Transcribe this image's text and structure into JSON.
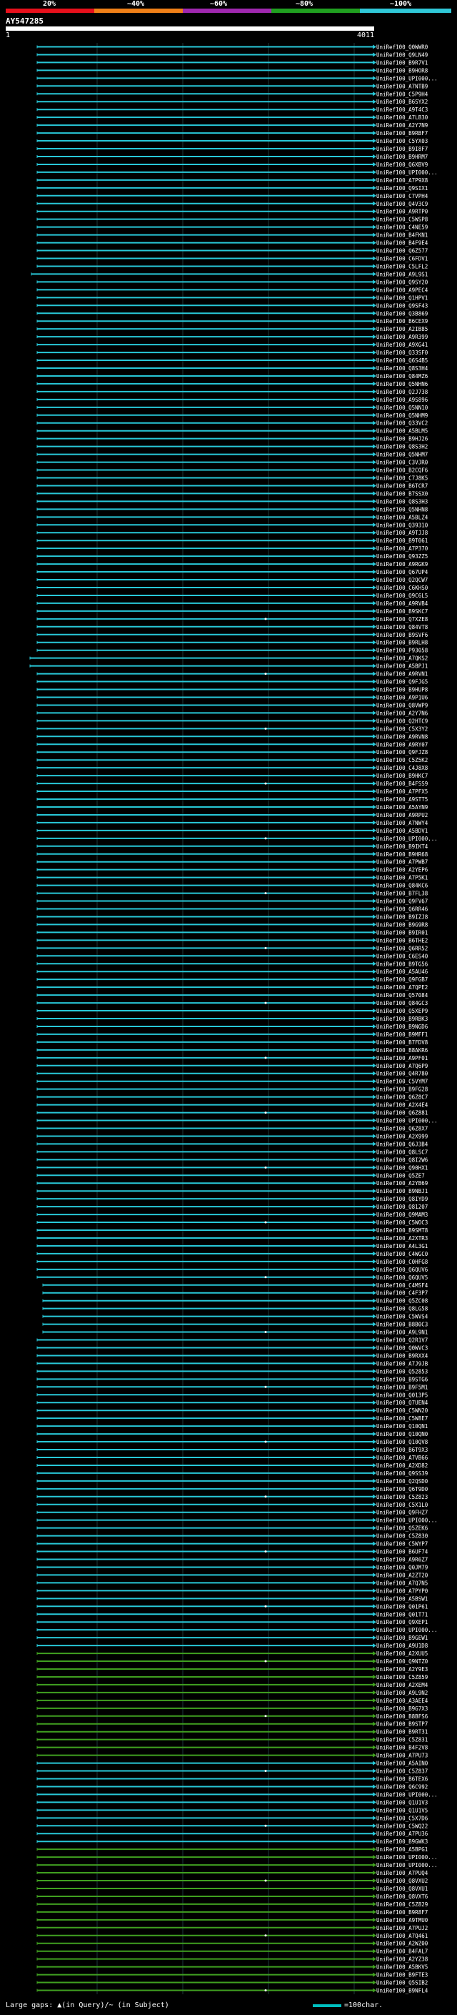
{
  "query": {
    "id": "AY547285",
    "start": "1",
    "end": "4011"
  },
  "scale_labels": [
    "20%",
    "~40%",
    "~60%",
    "~80%",
    "~100%"
  ],
  "scale_colors": [
    "#e8101c",
    "#f08018",
    "#a028b0",
    "#20a020",
    "#30c8d8"
  ],
  "colors": {
    "hit_cyan": "#28c8d8",
    "hit_green": "#40a020",
    "label": "#ffffff",
    "background": "#000000",
    "query_bar": "#ffffff"
  },
  "footer": {
    "left": "Large gaps: ▲(in Query)/~ (in Subject)",
    "right": "=100char."
  },
  "hits": [
    "UniRef100_Q0WWR0",
    "UniRef100_Q9LN49",
    "UniRef100_B9R7V1",
    "UniRef100_B9HOR8",
    "UniRef100_UPI000...",
    "UniRef100_A7NTB9",
    "UniRef100_C5P9H4",
    "UniRef100_B6SYX2",
    "UniRef100_A9T4C3",
    "UniRef100_A7LB30",
    "UniRef100_A2Y7N9",
    "UniRef100_B9RBF7",
    "UniRef100_C5YX03",
    "UniRef100_B9I8F7",
    "UniRef100_B9HRM7",
    "UniRef100_Q6XBV9",
    "UniRef100_UPI000...",
    "UniRef100_A7P9X8",
    "UniRef100_Q9SIX1",
    "UniRef100_C7VPH4",
    "UniRef100_Q4V3C9",
    "UniRef100_A9RTP0",
    "UniRef100_C5WSP8",
    "UniRef100_C4NE59",
    "UniRef100_B4FKN1",
    "UniRef100_B4F9E4",
    "UniRef100_Q6Z577",
    "UniRef100_C6FDV1",
    "UniRef100_C5LFL2",
    "UniRef100_A9L9S1",
    "UniRef100_Q9SY20",
    "UniRef100_A9PEC4",
    "UniRef100_Q1HPV1",
    "UniRef100_Q9SF43",
    "UniRef100_Q3B869",
    "UniRef100_B6CEX9",
    "UniRef100_A2IB85",
    "UniRef100_A9R399",
    "UniRef100_A9XG41",
    "UniRef100_Q33SF0",
    "UniRef100_Q6S4B5",
    "UniRef100_Q8S3H4",
    "UniRef100_Q84MZ6",
    "UniRef100_Q5NHN6",
    "UniRef100_Q2J738",
    "UniRef100_A9S896",
    "UniRef100_Q5NN10",
    "UniRef100_Q5NHM9",
    "UniRef100_Q33VC2",
    "UniRef100_A5BLM5",
    "UniRef100_B9HJ26",
    "UniRef100_Q8S3H2",
    "UniRef100_Q5NHM7",
    "UniRef100_C3VJR0",
    "UniRef100_B2CQF6",
    "UniRef100_C7J8K5",
    "UniRef100_B6TCR7",
    "UniRef100_B7SSX0",
    "UniRef100_Q8S3H3",
    "UniRef100_Q5NHN8",
    "UniRef100_A5BLZ4",
    "UniRef100_Q39310",
    "UniRef100_A9TJJ8",
    "UniRef100_B9T061",
    "UniRef100_A7P370",
    "UniRef100_Q93ZZ5",
    "UniRef100_A9RGK9",
    "UniRef100_Q67UP4",
    "UniRef100_Q2QCW7",
    "UniRef100_C6KHS0",
    "UniRef100_Q9C6L5",
    "UniRef100_A9RVB4",
    "UniRef100_B9SKC7",
    "UniRef100_Q7XZE8",
    "UniRef100_Q84VT8",
    "UniRef100_B9SVF6",
    "UniRef100_B9RLH8",
    "UniRef100_P93058",
    "UniRef100_A7QKS2",
    "UniRef100_A5BPJ1",
    "UniRef100_A9RVN1",
    "UniRef100_Q9FJG5",
    "UniRef100_B9HUP8",
    "UniRef100_A9P1U6",
    "UniRef100_Q8VWP9",
    "UniRef100_A2Y7N6",
    "UniRef100_Q2HTC9",
    "UniRef100_C5X3Y2",
    "UniRef100_A9RVN8",
    "UniRef100_A9RY07",
    "UniRef100_Q9FJZ8",
    "UniRef100_C5Z5K2",
    "UniRef100_C4J8X8",
    "UniRef100_B9HKC7",
    "UniRef100_B4FSS9",
    "UniRef100_A7PFX5",
    "UniRef100_A9STT5",
    "UniRef100_A5AYN9",
    "UniRef100_A9RPU2",
    "UniRef100_A7NWY4",
    "UniRef100_A5BDV1",
    "UniRef100_UPI000...",
    "UniRef100_B9IKT4",
    "UniRef100_B9HR68",
    "UniRef100_A7PWB7",
    "UniRef100_A2YEP6",
    "UniRef100_A7P5K1",
    "UniRef100_Q84KC6",
    "UniRef100_B7FL38",
    "UniRef100_Q9FV67",
    "UniRef100_Q6RR46",
    "UniRef100_B9IZJ8",
    "UniRef100_B9G9R8",
    "UniRef100_B9IR01",
    "UniRef100_B6THE2",
    "UniRef100_Q6RR52",
    "UniRef100_C6ES40",
    "UniRef100_B9TG56",
    "UniRef100_A5AU46",
    "UniRef100_Q9FGB7",
    "UniRef100_A7QPE2",
    "UniRef100_Q57084",
    "UniRef100_Q84GC3",
    "UniRef100_Q5XEP9",
    "UniRef100_B9RBK3",
    "UniRef100_B9NGD6",
    "UniRef100_B9MFF1",
    "UniRef100_B7FDV8",
    "UniRef100_B8AKR6",
    "UniRef100_A9PF01",
    "UniRef100_A7Q6P9",
    "UniRef100_Q4R780",
    "UniRef100_C5VYM7",
    "UniRef100_B9FG28",
    "UniRef100_Q6Z8C7",
    "UniRef100_A2X4E4",
    "UniRef100_Q6Z881",
    "UniRef100_UPI000...",
    "UniRef100_Q6Z8X7",
    "UniRef100_A2X999",
    "UniRef100_Q6J3B4",
    "UniRef100_Q8LSC7",
    "UniRef100_Q8I2W6",
    "UniRef100_Q90HX1",
    "UniRef100_Q5ZE7",
    "UniRef100_A2YB69",
    "UniRef100_B9NBJ1",
    "UniRef100_Q8IYD9",
    "UniRef100_Q81207",
    "UniRef100_Q9MAM3",
    "UniRef100_C5WOC3",
    "UniRef100_B9SMT8",
    "UniRef100_A2XTR3",
    "UniRef100_A4L3G1",
    "UniRef100_C4WGC0",
    "UniRef100_C0HFG8",
    "UniRef100_Q6QUV6",
    "UniRef100_Q6QUV5",
    "UniRef100_C4MSF4",
    "UniRef100_C4F3P7",
    "UniRef100_Q5ZC08",
    "UniRef100_Q8LG58",
    "UniRef100_C5WVS4",
    "UniRef100_B8B0C3",
    "UniRef100_A9L9N1",
    "UniRef100_Q2R1V7",
    "UniRef100_Q0WVC3",
    "UniRef100_B9RXX4",
    "UniRef100_A7J9JB",
    "UniRef100_Q52853",
    "UniRef100_B9STG6",
    "UniRef100_B9F5M1",
    "UniRef100_Q013P5",
    "UniRef100_Q7UEN4",
    "UniRef100_C5WN20",
    "UniRef100_C5W8E7",
    "UniRef100_Q10QN1",
    "UniRef100_Q10QN0",
    "UniRef100_Q10QV8",
    "UniRef100_B6T9X3",
    "UniRef100_A7VB66",
    "UniRef100_A2XD82",
    "UniRef100_Q9SS39",
    "UniRef100_Q2QSD0",
    "UniRef100_Q6T9D0",
    "UniRef100_C5Z823",
    "UniRef100_C5X1L0",
    "UniRef100_Q9FHZ7",
    "UniRef100_UPI000...",
    "UniRef100_Q5ZEK6",
    "UniRef100_C5Z830",
    "UniRef100_C5WYP7",
    "UniRef100_B6UF74",
    "UniRef100_A9R6Z7",
    "UniRef100_Q0JM79",
    "UniRef100_A2ZT20",
    "UniRef100_A7Q7N5",
    "UniRef100_A7PYP0",
    "UniRef100_A5BSW1",
    "UniRef100_Q01P61",
    "UniRef100_Q01T71",
    "UniRef100_Q9XEP1",
    "UniRef100_UPI000...",
    "UniRef100_B9GEW1",
    "UniRef100_A9U1D8",
    "UniRef100_A2XUU5",
    "UniRef100_Q9NTZ0",
    "UniRef100_A2Y9E3",
    "UniRef100_C5Z859",
    "UniRef100_A2XEM4",
    "UniRef100_A9L9N2",
    "UniRef100_A3AEE4",
    "UniRef100_B9G7X3",
    "UniRef100_B8BFS6",
    "UniRef100_B9STP7",
    "UniRef100_B9RT31",
    "UniRef100_C5Z831",
    "UniRef100_B4F2V8",
    "UniRef100_A7PU73",
    "UniRef100_A5AIN0",
    "UniRef100_C5Z837",
    "UniRef100_B6TEX6",
    "UniRef100_Q6C992",
    "UniRef100_UPI000...",
    "UniRef100_Q1U1V3",
    "UniRef100_Q1U1V5",
    "UniRef100_C5X7D6",
    "UniRef100_C5WQ22",
    "UniRef100_A7PU36",
    "UniRef100_B9GWK3",
    "UniRef100_A5BPG1",
    "UniRef100_UPI000...",
    "UniRef100_UPI000...",
    "UniRef100_A7PUQ4",
    "UniRef100_Q8VXU2",
    "UniRef100_Q8VXU1",
    "UniRef100_Q8VXT6",
    "UniRef100_C5Z829",
    "UniRef100_B9R8F7",
    "UniRef100_A9TMU0",
    "UniRef100_A7PUJ2",
    "UniRef100_A7Q461",
    "UniRef100_A2WZ00",
    "UniRef100_B4FAL7",
    "UniRef100_A2YZ38",
    "UniRef100_A5BKV5",
    "UniRef100_B9FTE3",
    "UniRef100_Q5SIB2",
    "UniRef100_B9NFL4"
  ]
}
